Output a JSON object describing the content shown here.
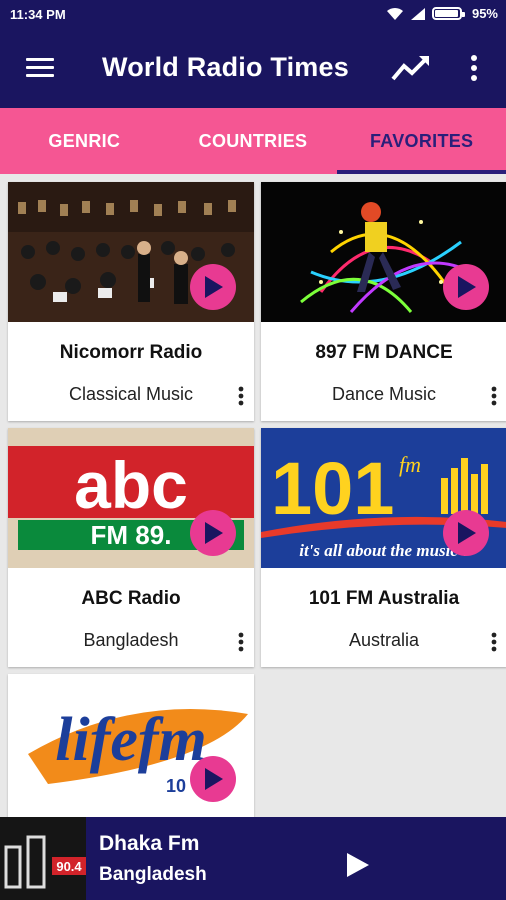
{
  "status": {
    "time": "11:34 PM",
    "battery": "95%"
  },
  "appbar": {
    "title": "World Radio Times"
  },
  "tabs": [
    {
      "label": "GENRIC"
    },
    {
      "label": "COUNTRIES"
    },
    {
      "label": "FAVORITES"
    }
  ],
  "stations": [
    {
      "name": "Nicomorr Radio",
      "subtitle": "Classical Music"
    },
    {
      "name": "897 FM DANCE",
      "subtitle": "Dance Music"
    },
    {
      "name": "ABC Radio",
      "subtitle": "Bangladesh",
      "logo_text": "abc",
      "logo_sub": "FM 89."
    },
    {
      "name": "101 FM Australia",
      "subtitle": "Australia",
      "logo_text": "101",
      "logo_fm": "fm",
      "logo_tagline": "it's all about the music !"
    },
    {
      "name": "",
      "subtitle": "",
      "logo_text": "lifefm",
      "logo_num": "10"
    }
  ],
  "player": {
    "station": "Dhaka Fm",
    "country": "Bangladesh",
    "art_text": "90.4"
  },
  "colors": {
    "primary": "#1a1560",
    "accent": "#f55693",
    "play": "#e83a92",
    "active_tab": "#2a1f7a"
  }
}
